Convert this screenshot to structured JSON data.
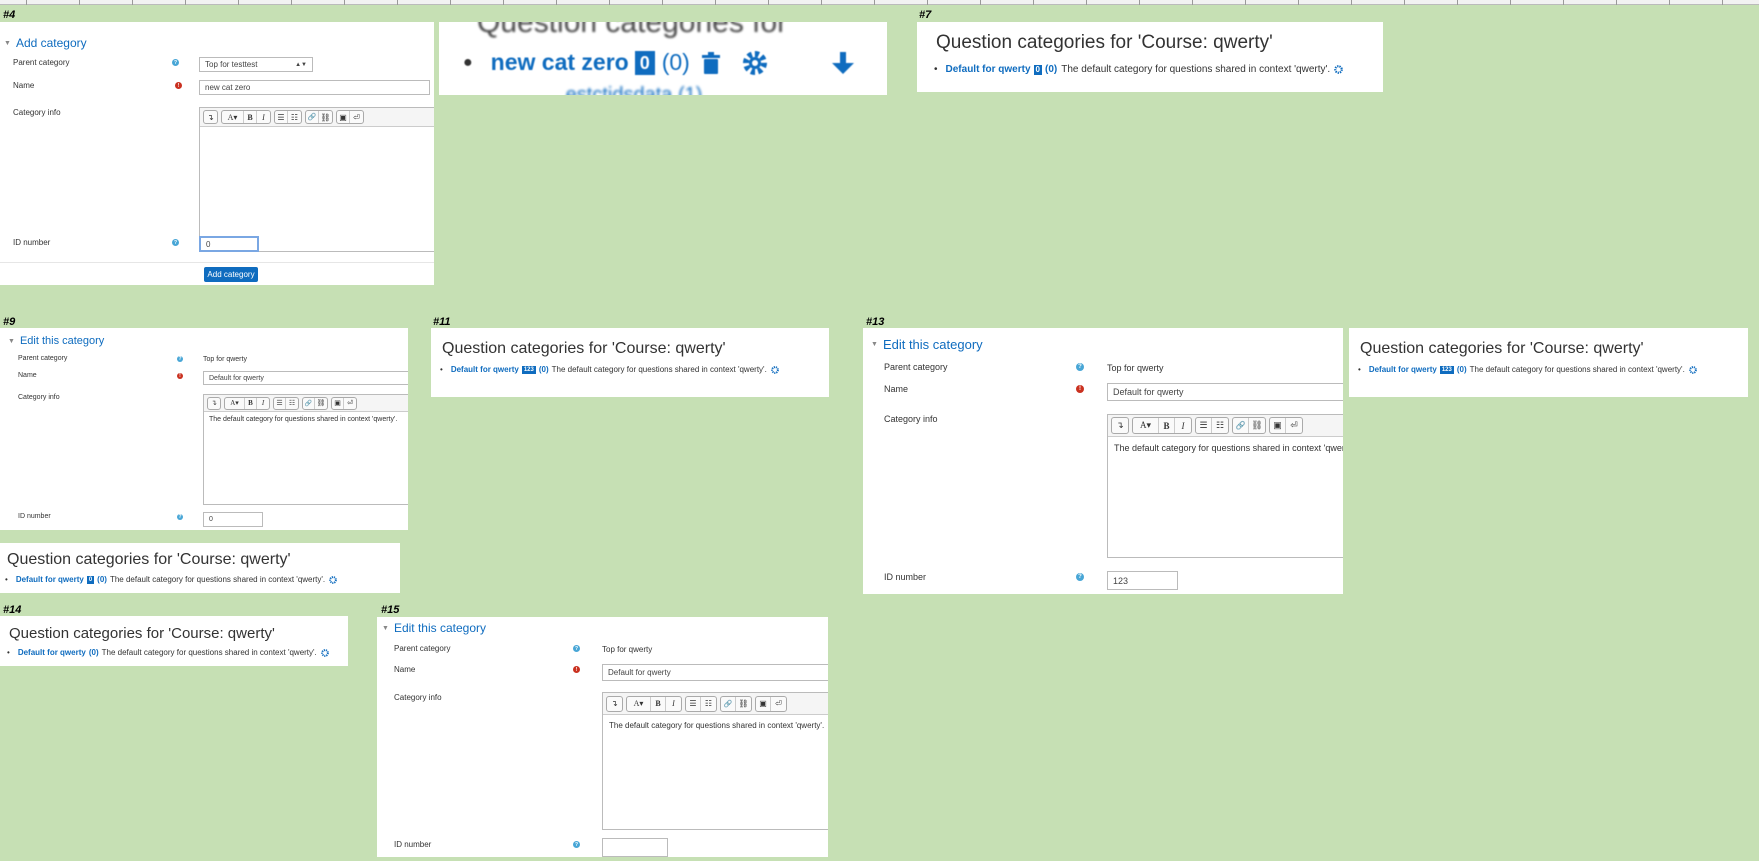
{
  "labels": {
    "s4": "#4",
    "s7": "#7",
    "s9": "#9",
    "s11": "#11",
    "s13": "#13",
    "s14": "#14",
    "s15": "#15"
  },
  "form4": {
    "legend": "Add category",
    "parent_label": "Parent category",
    "parent_value": "Top for testtest",
    "name_label": "Name",
    "name_value": "new cat zero",
    "info_label": "Category info",
    "info_value": "",
    "idnumber_label": "ID number",
    "idnumber_value": "0",
    "submit_label": "Add category"
  },
  "zoom": {
    "heading_fragment": "Question categories for",
    "item1_name": "new cat zero",
    "item1_id": "0",
    "item1_count": "(0)",
    "item2_fragment": "...estctidsdata (1)"
  },
  "qc_common": {
    "title": "Question categories for 'Course: qwerty'",
    "link": "Default for qwerty",
    "count": "(0)",
    "desc": "The default category for questions shared in context 'qwerty'."
  },
  "qc7": {
    "id": "0"
  },
  "qc9b": {
    "id": "0"
  },
  "qc11": {
    "id": "123"
  },
  "qc13b": {
    "id": "123"
  },
  "edit_common": {
    "legend": "Edit this category",
    "parent_label": "Parent category",
    "parent_value": "Top for qwerty",
    "name_label": "Name",
    "name_value": "Default for qwerty",
    "info_label": "Category info",
    "info_value": "The default category for questions shared in context 'qwerty'.",
    "idnumber_label": "ID number"
  },
  "form9": {
    "idnumber_value": "0"
  },
  "form13": {
    "idnumber_value": "123"
  },
  "form15": {
    "idnumber_value": ""
  },
  "toolbar": {
    "b1": "↴",
    "b2": "A▾",
    "b3": "B",
    "b4": "I",
    "b5": "☰",
    "b6": "☷",
    "b7": "🔗",
    "b8": "⛓",
    "b9": "▣",
    "b10": "⏎"
  },
  "icons": {
    "help": "question-circle",
    "required": "exclamation-circle",
    "gear": "cog",
    "trash": "trash",
    "arrow": "arrow-down"
  },
  "colors": {
    "background": "#c6e0b4",
    "link": "#0f6cbf",
    "help": "#48a6d6",
    "required": "#ca3120"
  }
}
